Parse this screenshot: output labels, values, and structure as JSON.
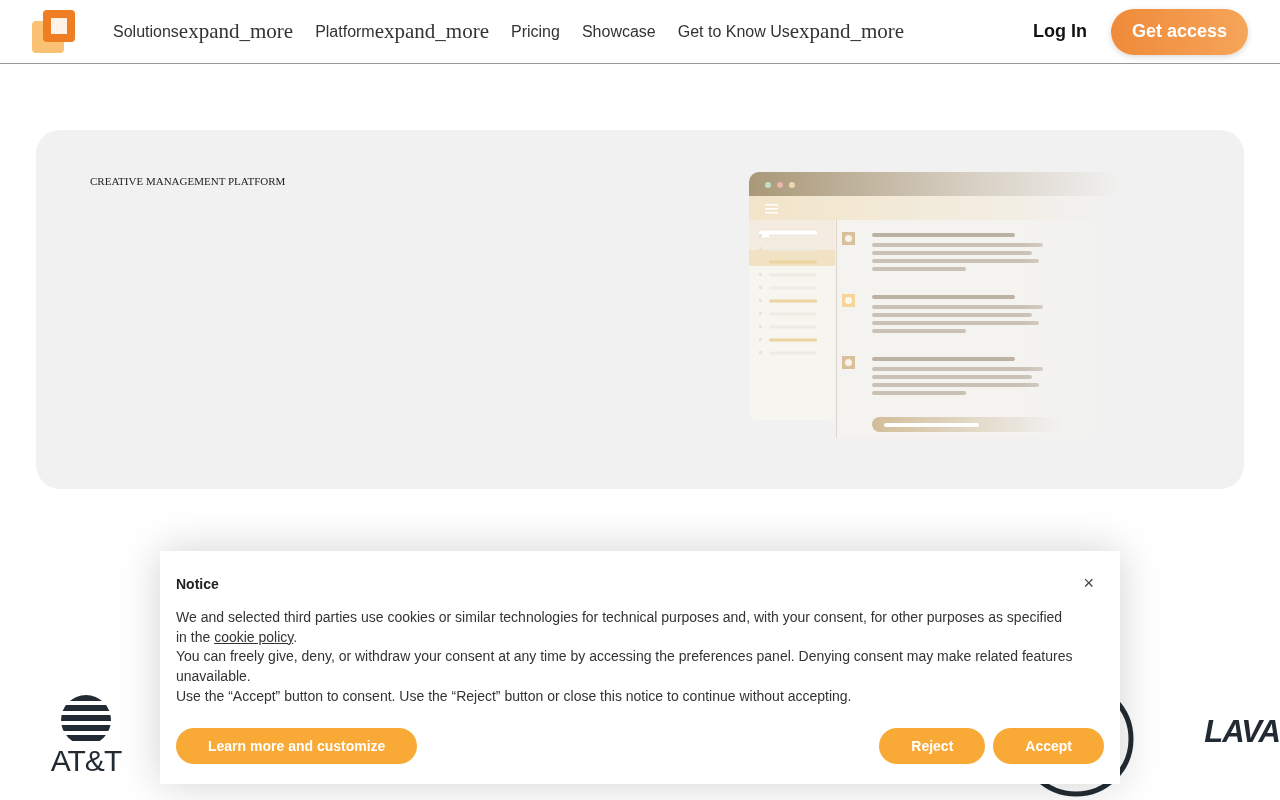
{
  "header": {
    "nav": [
      {
        "label": "Solutions",
        "menu_icon": "expand_more"
      },
      {
        "label": "Platform",
        "menu_icon": "expand_more"
      },
      {
        "label": "Pricing"
      },
      {
        "label": "Showcase"
      },
      {
        "label": "Get to Know Us",
        "menu_icon": "expand_more"
      }
    ],
    "login": "Log In",
    "cta": "Get access"
  },
  "hero": {
    "eyebrow": "CREATIVE MANAGEMENT PLATFORM"
  },
  "logos": [
    {
      "kind": "globe",
      "name": "AT&T"
    },
    {
      "kind": "ring"
    },
    {
      "kind": "wordmark",
      "name": "LAVA"
    }
  ],
  "notice": {
    "title": "Notice",
    "close": "×",
    "paragraphs": [
      {
        "text": "We and selected third parties use cookies or similar technologies for technical purposes and, with your consent, for other purposes as specified in the",
        "link": "cookie policy",
        "after": "."
      },
      {
        "text": "You can freely give, deny, or withdraw your consent at any time by accessing the preferences panel. Denying consent may make related features unavailable."
      },
      {
        "text": "Use the “Accept” button to consent. Use the “Reject” button or close this notice to continue without accepting."
      }
    ],
    "buttons": [
      {
        "label": "Learn more and customize",
        "kind": "secondary"
      },
      {
        "label": "Reject",
        "kind": "primary"
      },
      {
        "label": "Accept",
        "kind": "primary"
      }
    ]
  }
}
